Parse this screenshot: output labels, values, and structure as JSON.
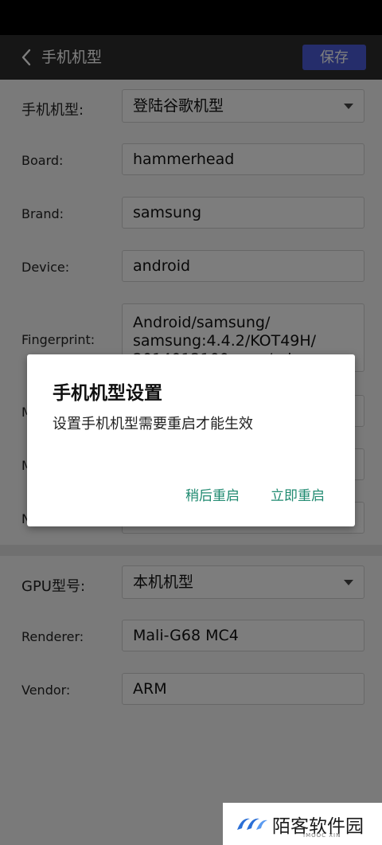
{
  "app_bar": {
    "title": "手机机型",
    "save_label": "保存"
  },
  "phone_section": {
    "model_label": "手机机型:",
    "model_value": "登陆谷歌机型",
    "rows": [
      {
        "label": "Board:",
        "value": "hammerhead"
      },
      {
        "label": "Brand:",
        "value": "samsung"
      },
      {
        "label": "Device:",
        "value": "android"
      }
    ],
    "fingerprint_label": "Fingerprint:",
    "fingerprint_value": "Android/samsung/ samsung:4.4.2/KOT49H/ 2014012100:user/release-keys",
    "partial_labels": [
      "M",
      "M",
      "N"
    ]
  },
  "gpu_section": {
    "gpu_label": "GPU型号:",
    "gpu_value": "本机机型",
    "renderer_label": "Renderer:",
    "renderer_value": "Mali-G68 MC4",
    "vendor_label": "Vendor:",
    "vendor_value": "ARM"
  },
  "dialog": {
    "title": "手机机型设置",
    "message": "设置手机机型需要重启才能生效",
    "later_label": "稍后重启",
    "now_label": "立即重启"
  },
  "watermark": {
    "text": "陌客软件园",
    "sub": "IMOOC XIN"
  },
  "colors": {
    "accent_button": "#4a5bd6",
    "dialog_button": "#1f8a70",
    "app_bar": "#2c2c2c"
  }
}
